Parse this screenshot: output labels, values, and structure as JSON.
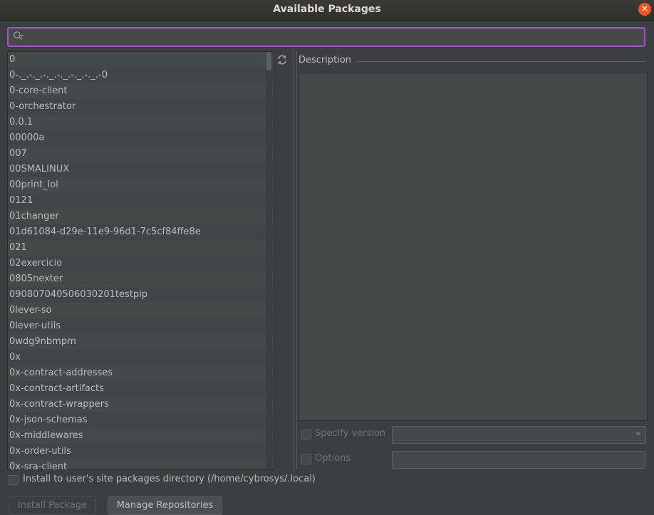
{
  "window": {
    "title": "Available Packages",
    "close_glyph": "×"
  },
  "search": {
    "value": "",
    "placeholder": "",
    "icon": "search-icon"
  },
  "packages": [
    "0",
    "0-._.-._.-._.-._.-._.-._.-0",
    "0-core-client",
    "0-orchestrator",
    "0.0.1",
    "00000a",
    "007",
    "00SMALINUX",
    "00print_lol",
    "0121",
    "01changer",
    "01d61084-d29e-11e9-96d1-7c5cf84ffe8e",
    "021",
    "02exercicio",
    "0805nexter",
    "090807040506030201testpip",
    "0lever-so",
    "0lever-utils",
    "0wdg9nbmpm",
    "0x",
    "0x-contract-addresses",
    "0x-contract-artifacts",
    "0x-contract-wrappers",
    "0x-json-schemas",
    "0x-middlewares",
    "0x-order-utils",
    "0x-sra-client"
  ],
  "details": {
    "description_label": "Description",
    "description_text": "",
    "specify_version_label": "Specify version",
    "specify_version_value": "",
    "options_label": "Options",
    "options_value": ""
  },
  "footer": {
    "install_user_label": "Install to user's site packages directory (/home/cybrosys/.local)",
    "install_button": "Install Package",
    "manage_button": "Manage Repositories"
  },
  "colors": {
    "background": "#3c3f41",
    "list_background": "#45494a",
    "search_focus_border": "#9b59b6",
    "close_button": "#e95420",
    "text": "#bbbbbb",
    "disabled_text": "#6f7273"
  }
}
